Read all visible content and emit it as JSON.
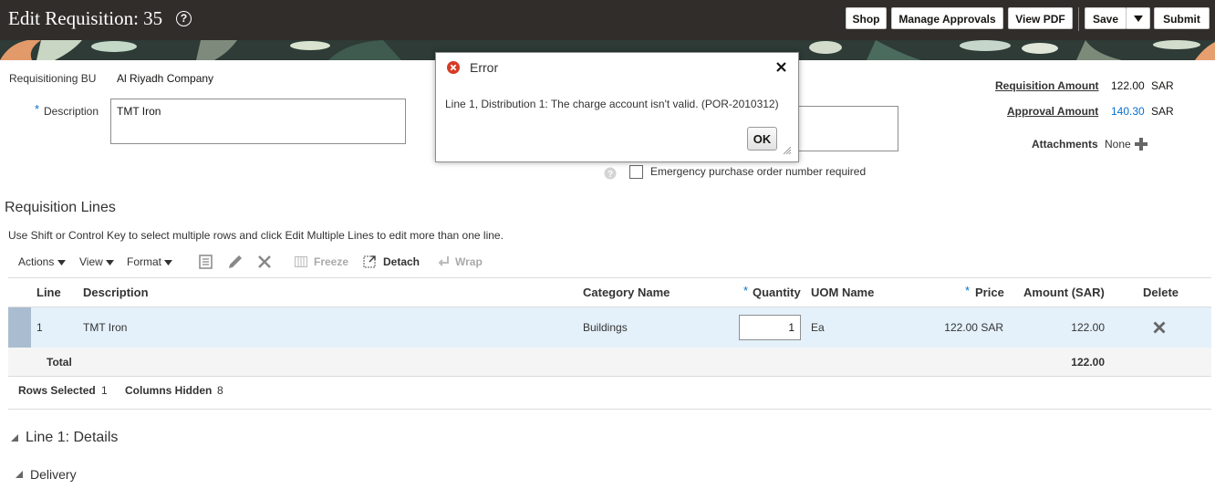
{
  "header": {
    "title": "Edit Requisition: 35",
    "help_glyph": "?",
    "buttons": {
      "shop": "Shop",
      "manage_approvals": "Manage Approvals",
      "view_pdf": "View PDF",
      "save": "Save",
      "submit": "Submit"
    }
  },
  "form": {
    "requisitioning_bu_label": "Requisitioning BU",
    "requisitioning_bu_value": "Al Riyadh Company",
    "description_required": "*",
    "description_label": "Description",
    "description_value": "TMT Iron",
    "emergency_label": "Emergency purchase order number required",
    "requisition_amount_label": "Requisition Amount",
    "requisition_amount_value": "122.00",
    "requisition_amount_currency": "SAR",
    "approval_amount_label": "Approval Amount",
    "approval_amount_value": "140.30",
    "approval_amount_currency": "SAR",
    "attachments_label": "Attachments",
    "attachments_value": "None"
  },
  "dialog": {
    "title": "Error",
    "message": "Line 1, Distribution 1: The charge account isn't valid. (POR-2010312)",
    "ok_label": "OK"
  },
  "lines": {
    "section_title": "Requisition Lines",
    "instruction": "Use Shift or Control Key to select multiple rows and click Edit Multiple Lines to edit more than one line.",
    "toolbar": {
      "actions": "Actions",
      "view": "View",
      "format": "Format",
      "freeze": "Freeze",
      "detach": "Detach",
      "wrap": "Wrap"
    },
    "columns": {
      "line": "Line",
      "description": "Description",
      "category": "Category Name",
      "quantity": "Quantity",
      "uom": "UOM Name",
      "price": "Price",
      "amount": "Amount (SAR)",
      "delete": "Delete"
    },
    "rows": [
      {
        "line": "1",
        "description": "TMT Iron",
        "category": "Buildings",
        "quantity": "1",
        "uom": "Ea",
        "price": "122.00 SAR",
        "amount": "122.00"
      }
    ],
    "total_label": "Total",
    "total_value": "122.00",
    "status": {
      "rows_selected_label": "Rows Selected",
      "rows_selected_value": "1",
      "columns_hidden_label": "Columns Hidden",
      "columns_hidden_value": "8"
    }
  },
  "details": {
    "line_details_title": "Line 1: Details",
    "delivery_title": "Delivery"
  },
  "colors": {
    "header_bg": "#312d2a",
    "link_blue": "#0572ce",
    "selected_row": "#e4f1fb",
    "error_red": "#d63b25"
  }
}
